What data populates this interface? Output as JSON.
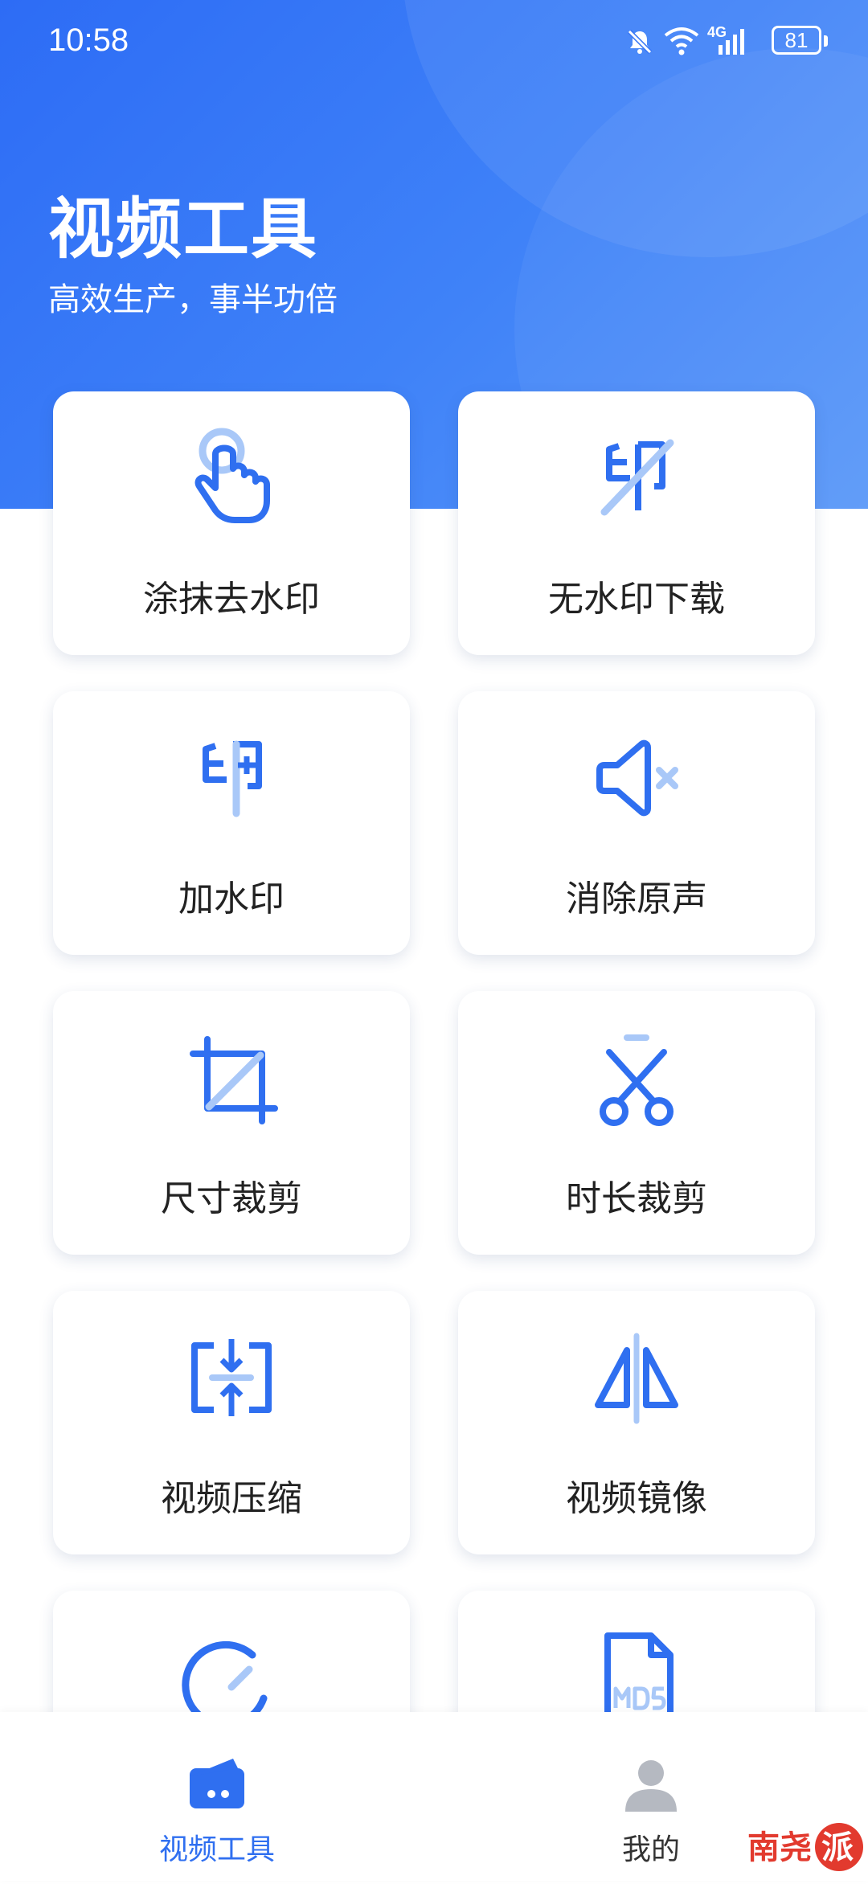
{
  "status_bar": {
    "time": "10:58",
    "network": "4G",
    "battery": "81"
  },
  "header": {
    "title": "视频工具",
    "subtitle": "高效生产，事半功倍"
  },
  "tools": [
    {
      "label": "涂抹去水印",
      "icon": "tap-finger-icon"
    },
    {
      "label": "无水印下载",
      "icon": "no-watermark-icon"
    },
    {
      "label": "加水印",
      "icon": "add-watermark-icon"
    },
    {
      "label": "消除原声",
      "icon": "mute-icon"
    },
    {
      "label": "尺寸裁剪",
      "icon": "crop-icon"
    },
    {
      "label": "时长裁剪",
      "icon": "scissors-icon"
    },
    {
      "label": "视频压缩",
      "icon": "compress-icon"
    },
    {
      "label": "视频镜像",
      "icon": "mirror-icon"
    },
    {
      "label": "",
      "icon": "speed-gauge-icon"
    },
    {
      "label": "",
      "icon": "md5-file-icon"
    }
  ],
  "bottom_nav": [
    {
      "label": "视频工具",
      "icon": "video-tools-icon",
      "active": true
    },
    {
      "label": "我的",
      "icon": "profile-icon",
      "active": false
    }
  ],
  "watermark": {
    "text": "南尧派",
    "icon": "site-logo"
  },
  "colors": {
    "accent": "#2f6ff0",
    "icon_light": "#a9c8f8",
    "card_text": "#222222"
  }
}
